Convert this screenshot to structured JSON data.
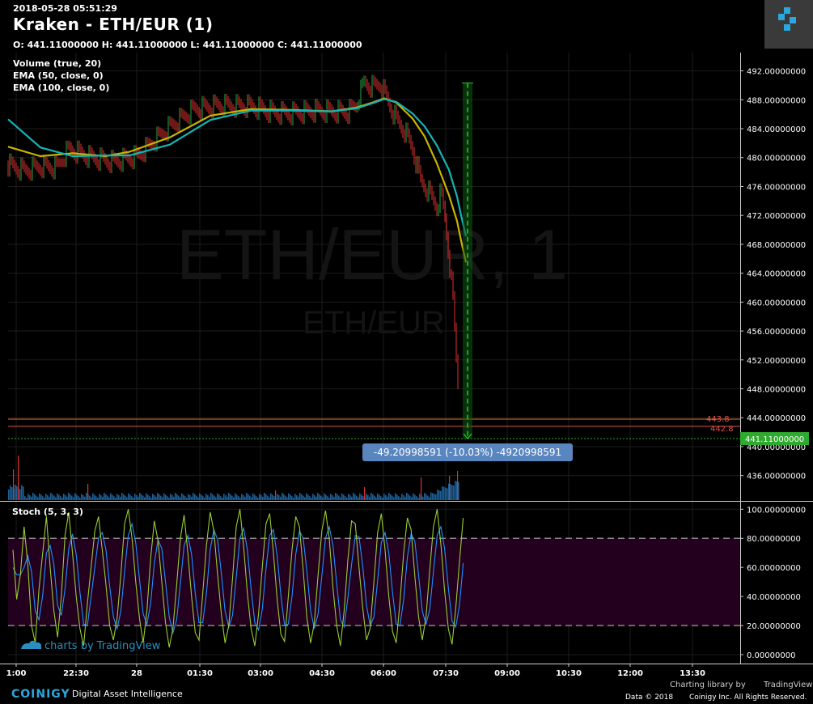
{
  "header": {
    "timestamp": "2018-05-28 05:51:29",
    "title": "Kraken - ETH/EUR (1)",
    "ohlc": "O: 441.11000000 H: 441.11000000 L: 441.11000000 C: 441.11000000"
  },
  "studies": [
    "Volume (true, 20)",
    "EMA (50, close, 0)",
    "EMA (100, close, 0)"
  ],
  "watermark": {
    "main": "ETH/EUR, 1",
    "sub": "ETH/EUR"
  },
  "colors": {
    "up": "#26a641",
    "down": "#e03030",
    "ema50": "#c8b400",
    "ema100": "#14b4b4",
    "volume": "#1e6aa8",
    "stoch_k": "#9acd32",
    "stoch_d": "#1e90ff",
    "stoch_band": "#22001e",
    "last_price": "#2eaa2e",
    "measure": "#22cc22"
  },
  "chart_data": [
    {
      "type": "line",
      "title": "Kraken - ETH/EUR (1)",
      "x_ticks": [
        "1:00",
        "22:30",
        "28",
        "01:30",
        "03:00",
        "04:30",
        "06:00",
        "07:30",
        "09:00",
        "10:30",
        "12:00",
        "13:30"
      ],
      "y_ticks": [
        "492.00000000",
        "488.00000000",
        "484.00000000",
        "480.00000000",
        "476.00000000",
        "472.00000000",
        "468.00000000",
        "464.00000000",
        "460.00000000",
        "456.00000000",
        "452.00000000",
        "448.00000000",
        "444.00000000",
        "440.00000000",
        "436.00000000"
      ],
      "ylim": [
        432.5,
        493.5
      ],
      "series": [
        {
          "name": "EMA (50, close, 0)",
          "x": [
            0,
            40,
            80,
            120,
            150,
            200,
            250,
            300,
            350,
            400,
            430,
            450,
            465,
            480,
            500,
            515,
            530,
            545,
            555,
            560,
            566
          ],
          "values": [
            481.5,
            480.2,
            480.6,
            480.2,
            480.8,
            482.8,
            485.8,
            486.7,
            486.6,
            486.4,
            486.9,
            487.6,
            488.2,
            487.6,
            485.4,
            482.9,
            479.2,
            474.8,
            471.2,
            468.5,
            465.5
          ]
        },
        {
          "name": "EMA (100, close, 0)",
          "x": [
            0,
            40,
            80,
            120,
            150,
            200,
            250,
            300,
            350,
            400,
            430,
            450,
            465,
            480,
            500,
            515,
            530,
            545,
            555,
            560,
            566
          ],
          "values": [
            485.3,
            481.4,
            480.2,
            480.3,
            480.3,
            481.8,
            485.2,
            486.5,
            486.5,
            486.4,
            486.8,
            487.5,
            488.1,
            487.7,
            486.1,
            484.3,
            481.7,
            478.3,
            474.6,
            472.0,
            469.1
          ]
        },
        {
          "name": "Price",
          "x": [
            0,
            20,
            40,
            60,
            75,
            100,
            130,
            160,
            200,
            230,
            260,
            300,
            330,
            350,
            380,
            420,
            430,
            440,
            450,
            460,
            470,
            480,
            490,
            500,
            510,
            520,
            530,
            535,
            540,
            545,
            550,
            555,
            560,
            566
          ],
          "values": [
            479,
            478.2,
            478.8,
            478.6,
            481.2,
            480.1,
            479.4,
            480.2,
            484.3,
            486.7,
            487.2,
            487.1,
            486.2,
            486.1,
            486.5,
            486.3,
            487.2,
            490.4,
            489.8,
            490.2,
            487.7,
            485.2,
            483.7,
            481.2,
            476.8,
            475.2,
            473.2,
            475.2,
            471.7,
            466.2,
            460.2,
            450.2,
            443.8,
            441.11
          ]
        }
      ],
      "last_price": "441.11000000",
      "line_443": "443.8",
      "line_442": "442.8",
      "measure": {
        "label": "-49.20998591 (-10.03%) -4920998591",
        "from": 490.32,
        "to": 441.11
      }
    },
    {
      "type": "line",
      "title": "Stoch (5, 3, 3)",
      "y_ticks": [
        "100.00000000",
        "80.00000000",
        "60.00000000",
        "40.00000000",
        "20.00000000",
        "0.00000000"
      ],
      "ylim": [
        -5,
        105
      ],
      "bands": [
        20,
        80
      ],
      "series": [
        {
          "name": "%K",
          "values": [
            72,
            38,
            55,
            88,
            62,
            20,
            8,
            45,
            70,
            95,
            60,
            30,
            12,
            40,
            82,
            98,
            70,
            40,
            18,
            6,
            35,
            60,
            85,
            95,
            72,
            48,
            20,
            10,
            25,
            55,
            90,
            100,
            80,
            50,
            25,
            8,
            30,
            66,
            92,
            78,
            50,
            22,
            5,
            18,
            48,
            80,
            96,
            70,
            40,
            15,
            10,
            42,
            75,
            98,
            85,
            55,
            28,
            8,
            20,
            52,
            88,
            100,
            74,
            42,
            18,
            6,
            28,
            60,
            90,
            97,
            70,
            38,
            14,
            9,
            40,
            72,
            95,
            88,
            58,
            25,
            8,
            22,
            55,
            85,
            99,
            80,
            46,
            20,
            6,
            30,
            65,
            92,
            90,
            60,
            32,
            10,
            18,
            50,
            84,
            97,
            72,
            40,
            16,
            8,
            36,
            70,
            94,
            86,
            54,
            26,
            10,
            26,
            58,
            88,
            100,
            76,
            44,
            18,
            7,
            32,
            64,
            94
          ]
        },
        {
          "name": "%D",
          "values": [
            60,
            55,
            55,
            60,
            68,
            57,
            30,
            24,
            41,
            70,
            75,
            62,
            34,
            27,
            45,
            73,
            83,
            69,
            43,
            21,
            20,
            40,
            60,
            80,
            84,
            72,
            47,
            26,
            18,
            30,
            57,
            82,
            90,
            77,
            52,
            28,
            21,
            35,
            63,
            79,
            73,
            50,
            26,
            15,
            24,
            49,
            75,
            82,
            69,
            42,
            22,
            22,
            42,
            72,
            86,
            79,
            56,
            30,
            19,
            27,
            53,
            80,
            87,
            72,
            45,
            22,
            17,
            31,
            59,
            82,
            86,
            68,
            41,
            20,
            21,
            40,
            69,
            85,
            80,
            57,
            30,
            18,
            28,
            54,
            80,
            88,
            75,
            49,
            24,
            19,
            39,
            62,
            82,
            81,
            61,
            34,
            20,
            26,
            51,
            77,
            84,
            70,
            43,
            21,
            20,
            38,
            67,
            83,
            78,
            55,
            30,
            21,
            31,
            57,
            82,
            88,
            73,
            46,
            23,
            19,
            34,
            63
          ]
        }
      ]
    }
  ],
  "footer": {
    "brand": "COINIGY",
    "tagline": "Digital Asset Intelligence",
    "tv_watermark": "charts by TradingView",
    "charting": "Charting library by",
    "tradingview": "TradingView",
    "data_prefix": "Data © 2018",
    "rights": "Coinigy Inc. All Rights Reserved."
  }
}
